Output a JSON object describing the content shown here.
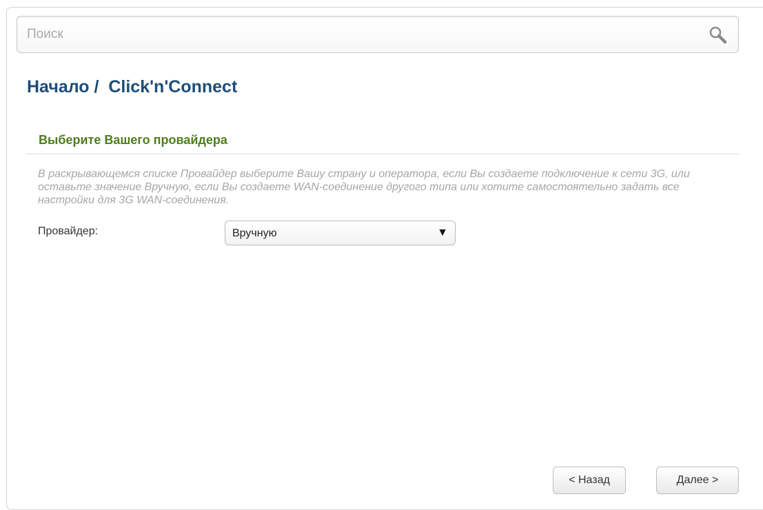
{
  "search": {
    "placeholder": "Поиск",
    "icon": "search-icon"
  },
  "breadcrumb": {
    "text": "Начало /  Click'n'Connect"
  },
  "section": {
    "title": "Выберите Вашего провайдера",
    "description": "В раскрывающемся списке Провайдер выберите Вашу страну и оператора, если Вы создаете подключение к сети 3G, или оставьте значение Вручную, если Вы создаете WAN-соединение другого типа или хотите самостоятельно задать все настройки для 3G WAN-соединения."
  },
  "form": {
    "provider_label": "Провайдер:",
    "provider_value": "Вручную",
    "dropdown_arrow": "▼"
  },
  "buttons": {
    "back": "< Назад",
    "next": "Далее >"
  },
  "colors": {
    "title": "#1d4d78",
    "section_title": "#4e7d1e",
    "description": "#a6a6a6"
  }
}
